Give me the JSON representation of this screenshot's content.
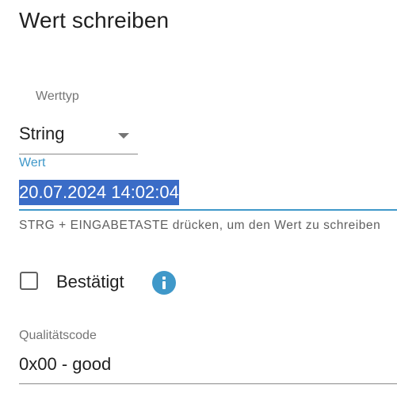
{
  "dialog": {
    "title": "Wert schreiben"
  },
  "type_select": {
    "label": "Werttyp",
    "value": "String",
    "icon": "dropdown-arrow-icon"
  },
  "value_input": {
    "label": "Wert",
    "value": "20.07.2024 14:02:04",
    "selected": true,
    "helper_text": "STRG + EINGABETASTE drücken, um den Wert zu schreiben",
    "accent_color": "#3f98c9",
    "selection_color": "#3a6cc7"
  },
  "ack_checkbox": {
    "label": "Bestätigt",
    "checked": false,
    "info_icon": "info-icon"
  },
  "quality": {
    "label": "Qualitätscode",
    "value": "0x00 - good"
  }
}
